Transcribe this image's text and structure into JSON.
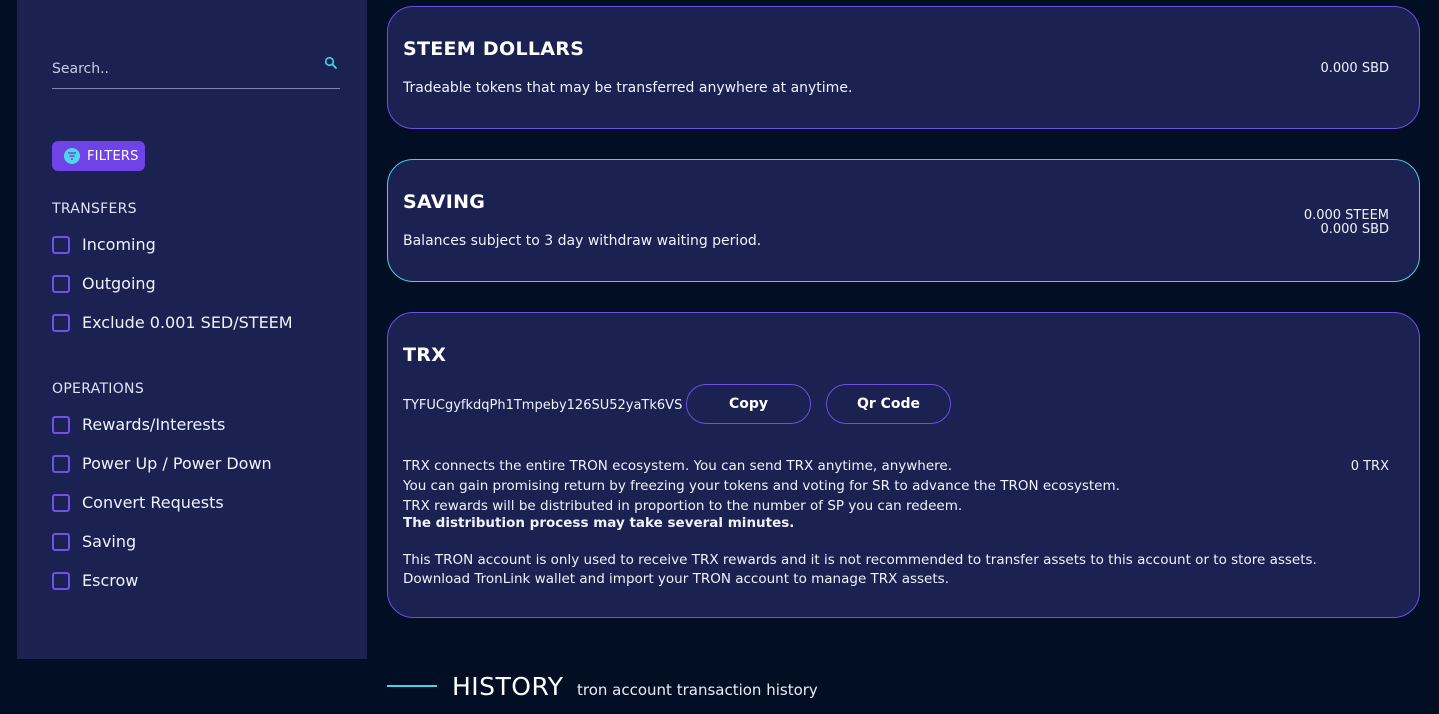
{
  "sidebar": {
    "search": {
      "placeholder": "Search..",
      "value": ""
    },
    "filters_label": "FILTERS",
    "transfers_title": "TRANSFERS",
    "transfers": [
      {
        "label": "Incoming",
        "checked": false
      },
      {
        "label": "Outgoing",
        "checked": false
      },
      {
        "label": "Exclude 0.001 SED/STEEM",
        "checked": false
      }
    ],
    "operations_title": "OPERATIONS",
    "operations": [
      {
        "label": "Rewards/Interests",
        "checked": false
      },
      {
        "label": "Power Up / Power Down",
        "checked": false
      },
      {
        "label": "Convert Requests",
        "checked": false
      },
      {
        "label": "Saving",
        "checked": false
      },
      {
        "label": "Escrow",
        "checked": false
      }
    ]
  },
  "cards": {
    "steem_dollars": {
      "title": "STEEM DOLLARS",
      "description": "Tradeable tokens that may be transferred anywhere at anytime.",
      "value": "0.000 SBD"
    },
    "saving": {
      "title": "SAVING",
      "description": "Balances subject to 3 day withdraw waiting period.",
      "value_steem": "0.000 STEEM",
      "value_sbd": "0.000 SBD"
    },
    "trx": {
      "title": "TRX",
      "address": "TYFUCgyfkdqPh1Tmpeby126SU52yaTk6VS",
      "copy_label": "Copy",
      "qr_label": "Qr Code",
      "value": "0 TRX",
      "lines": [
        "TRX connects the entire TRON ecosystem. You can send TRX anytime, anywhere.",
        "You can gain promising return by freezing your tokens and voting for SR to advance the TRON ecosystem.",
        "TRX rewards will be distributed in proportion to the number of SP you can redeem."
      ],
      "bold_line": "The distribution process may take several minutes.",
      "notes": [
        "This TRON account is only used to receive TRX rewards and it is not recommended to transfer assets to this account or to store assets.",
        "Download TronLink wallet and import your TRON account to manage TRX assets."
      ]
    }
  },
  "history": {
    "title": "HISTORY",
    "subtitle": "tron account transaction history"
  },
  "colors": {
    "background": "#020e24",
    "panel": "#1b2150",
    "accent_purple": "#6d4fe3",
    "accent_cyan": "#3fd5e2"
  }
}
